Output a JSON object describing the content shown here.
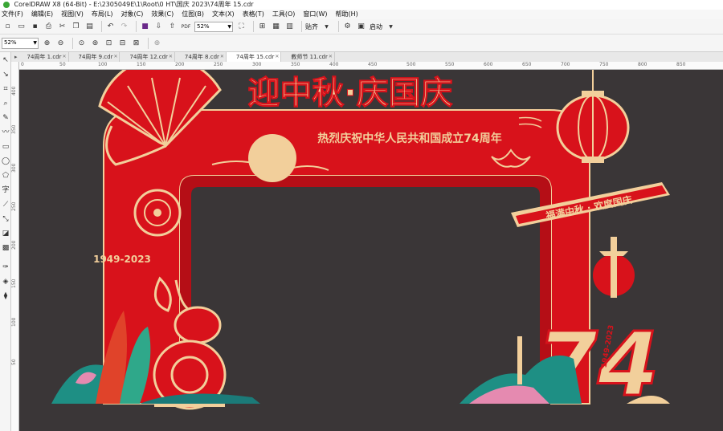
{
  "window": {
    "title": "CorelDRAW X8 (64-Bit) - E:\\2305049E\\1\\Root\\0 HT\\国庆 2023\\74周年 15.cdr"
  },
  "menu": [
    "文件(F)",
    "编辑(E)",
    "视图(V)",
    "布局(L)",
    "对象(C)",
    "效果(C)",
    "位图(B)",
    "文本(X)",
    "表格(T)",
    "工具(O)",
    "窗口(W)",
    "帮助(H)"
  ],
  "toolbar": {
    "zoom_value": "52%",
    "snap_label": "贴齐",
    "launch_label": "启动"
  },
  "propbar": {
    "zoom_value": "52%"
  },
  "tabs": [
    "74周年 1.cdr",
    "74周年 9.cdr",
    "74周年 12.cdr",
    "74周年 8.cdr",
    "74周年 15.cdr",
    "教师节 11.cdr"
  ],
  "ruler_h": [
    "0",
    "50",
    "100",
    "150",
    "200",
    "250",
    "300",
    "350",
    "400",
    "450",
    "500",
    "550",
    "600",
    "650",
    "700",
    "750",
    "800",
    "850"
  ],
  "ruler_v": [
    "400",
    "350",
    "300",
    "250",
    "200",
    "150",
    "100",
    "50"
  ],
  "artwork": {
    "headline": "迎中秋·庆国庆",
    "subtitle": "热烈庆祝中华人民共和国成立74周年",
    "ribbon_text": "福满中秋 · 欢度国庆",
    "year_badge": "1949-2023",
    "big_number": "74",
    "vertical_years": "1949-2023"
  },
  "colors": {
    "arch_red": "#d8121b",
    "gold": "#f2cf9b",
    "canvas_bg": "#3a3637"
  }
}
